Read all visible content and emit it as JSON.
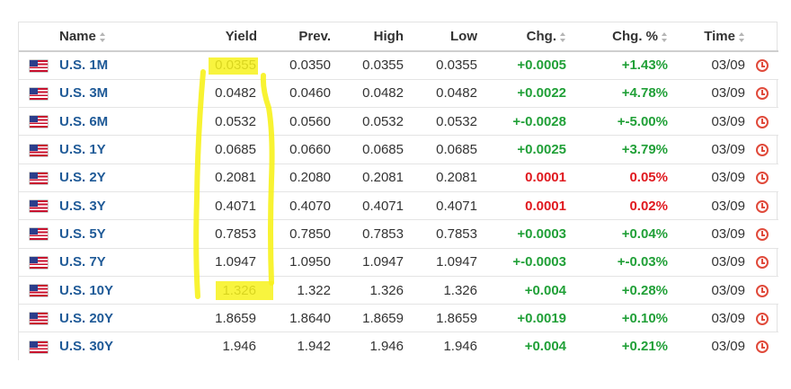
{
  "columns": {
    "name": "Name",
    "yield": "Yield",
    "prev": "Prev.",
    "high": "High",
    "low": "Low",
    "chg": "Chg.",
    "chg_pct": "Chg. %",
    "time": "Time"
  },
  "rows": [
    {
      "name": "U.S. 1M",
      "yield": "0.0355",
      "prev": "0.0350",
      "high": "0.0355",
      "low": "0.0355",
      "chg": "+0.0005",
      "chg_pct": "+1.43%",
      "time": "03/09",
      "direction": "up"
    },
    {
      "name": "U.S. 3M",
      "yield": "0.0482",
      "prev": "0.0460",
      "high": "0.0482",
      "low": "0.0482",
      "chg": "+0.0022",
      "chg_pct": "+4.78%",
      "time": "03/09",
      "direction": "up"
    },
    {
      "name": "U.S. 6M",
      "yield": "0.0532",
      "prev": "0.0560",
      "high": "0.0532",
      "low": "0.0532",
      "chg": "+-0.0028",
      "chg_pct": "+-5.00%",
      "time": "03/09",
      "direction": "up"
    },
    {
      "name": "U.S. 1Y",
      "yield": "0.0685",
      "prev": "0.0660",
      "high": "0.0685",
      "low": "0.0685",
      "chg": "+0.0025",
      "chg_pct": "+3.79%",
      "time": "03/09",
      "direction": "up"
    },
    {
      "name": "U.S. 2Y",
      "yield": "0.2081",
      "prev": "0.2080",
      "high": "0.2081",
      "low": "0.2081",
      "chg": "0.0001",
      "chg_pct": "0.05%",
      "time": "03/09",
      "direction": "down"
    },
    {
      "name": "U.S. 3Y",
      "yield": "0.4071",
      "prev": "0.4070",
      "high": "0.4071",
      "low": "0.4071",
      "chg": "0.0001",
      "chg_pct": "0.02%",
      "time": "03/09",
      "direction": "down"
    },
    {
      "name": "U.S. 5Y",
      "yield": "0.7853",
      "prev": "0.7850",
      "high": "0.7853",
      "low": "0.7853",
      "chg": "+0.0003",
      "chg_pct": "+0.04%",
      "time": "03/09",
      "direction": "up"
    },
    {
      "name": "U.S. 7Y",
      "yield": "1.0947",
      "prev": "1.0950",
      "high": "1.0947",
      "low": "1.0947",
      "chg": "+-0.0003",
      "chg_pct": "+-0.03%",
      "time": "03/09",
      "direction": "up"
    },
    {
      "name": "U.S. 10Y",
      "yield": "1.326",
      "prev": "1.322",
      "high": "1.326",
      "low": "1.326",
      "chg": "+0.004",
      "chg_pct": "+0.28%",
      "time": "03/09",
      "direction": "up"
    },
    {
      "name": "U.S. 20Y",
      "yield": "1.8659",
      "prev": "1.8640",
      "high": "1.8659",
      "low": "1.8659",
      "chg": "+0.0019",
      "chg_pct": "+0.10%",
      "time": "03/09",
      "direction": "up"
    },
    {
      "name": "U.S. 30Y",
      "yield": "1.946",
      "prev": "1.942",
      "high": "1.946",
      "low": "1.946",
      "chg": "+0.004",
      "chg_pct": "+0.21%",
      "time": "03/09",
      "direction": "up"
    }
  ],
  "icons": {
    "flag": "us-flag-icon",
    "clock": "clock-icon",
    "sort": "sort-arrows-icon"
  },
  "colors": {
    "link": "#1f5a97",
    "positive": "#21a038",
    "negative": "#e0191f",
    "clock": "#e04a3b",
    "highlighter": "#f7f21c"
  }
}
